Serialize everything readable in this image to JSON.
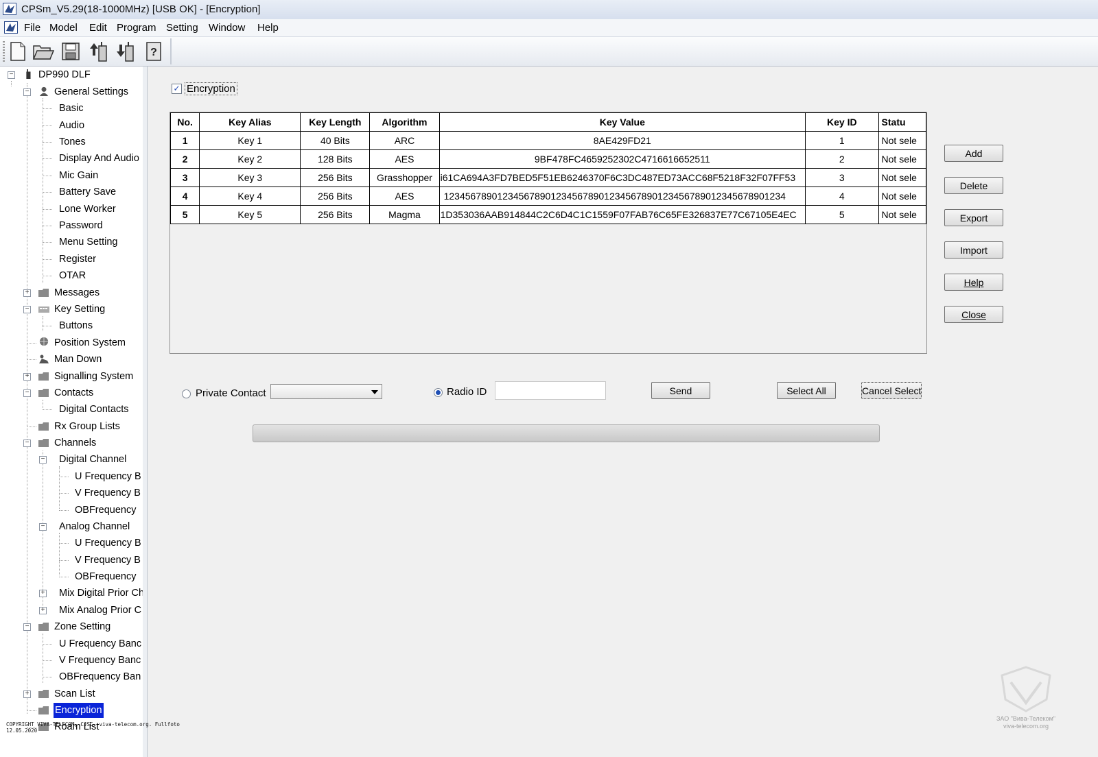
{
  "window": {
    "title": "CPSm_V5.29(18-1000MHz) [USB OK] - [Encryption]"
  },
  "menu": [
    "File",
    "Model",
    "Edit",
    "Program",
    "Setting",
    "Window",
    "Help"
  ],
  "toolbar": {
    "buttons": [
      "new-file-icon",
      "open-folder-icon",
      "save-icon",
      "read-from-radio-icon",
      "write-to-radio-icon",
      "help-book-icon"
    ]
  },
  "tree": {
    "root": "DP990 DLF",
    "items": [
      "General Settings",
      "Basic",
      "Audio",
      "Tones",
      "Display And Audio",
      "Mic Gain",
      "Battery Save",
      "Lone Worker",
      "Password",
      "Menu Setting",
      "Register",
      "OTAR",
      "Messages",
      "Key Setting",
      "Buttons",
      "Position System",
      "Man Down",
      "Signalling System",
      "Contacts",
      "Digital Contacts",
      "Rx Group Lists",
      "Channels",
      "Digital Channel",
      "U Frequency B",
      "V Frequency B",
      "OBFrequency",
      "Analog Channel",
      "U Frequency B",
      "V Frequency B",
      "OBFrequency",
      "Mix Digital Prior Ch",
      "Mix Analog Prior C",
      "Zone Setting",
      "U Frequency Banc",
      "V Frequency Banc",
      "OBFrequency Ban",
      "Scan List",
      "Encryption",
      "Roam List"
    ],
    "selected": "Encryption"
  },
  "encryption": {
    "checkbox_label": "Encryption",
    "checked": true,
    "columns": [
      "No.",
      "Key Alias",
      "Key Length",
      "Algorithm",
      "Key Value",
      "Key ID",
      "Statu"
    ],
    "rows": [
      [
        "1",
        "Key 1",
        "40 Bits",
        "ARC",
        "8AE429FD21",
        "1",
        "Not sele"
      ],
      [
        "2",
        "Key 2",
        "128 Bits",
        "AES",
        "9BF478FC4659252302C4716616652511",
        "2",
        "Not sele"
      ],
      [
        "3",
        "Key 3",
        "256 Bits",
        "Grasshopper",
        "i61CA694A3FD7BED5F51EB6246370F6C3DC487ED73ACC68F5218F32F07FF53",
        "3",
        "Not sele"
      ],
      [
        "4",
        "Key 4",
        "256 Bits",
        "AES",
        "1234567890123456789012345678901234567890123456789012345678901234",
        "4",
        "Not sele"
      ],
      [
        "5",
        "Key 5",
        "256 Bits",
        "Magma",
        "1D353036AAB914844C2C6D4C1C1559F07FAB76C65FE326837E77C67105E4EC",
        "5",
        "Not sele"
      ]
    ],
    "side_buttons": [
      "Add",
      "Delete",
      "Export",
      "Import",
      "Help",
      "Close"
    ],
    "private_contact_label": "Private Contact",
    "private_contact_value": "",
    "radio_id_label": "Radio ID",
    "radio_id_value": "",
    "send_label": "Send",
    "select_all_label": "Select All",
    "cancel_select_label": "Cancel Select"
  },
  "footer": {
    "copyright_line1": "COPYRIGHT VIVA-TELECOM, CJSC. viva-telecom.org. Fullfoto",
    "copyright_line2": "12.05.2020",
    "watermark_line1": "ЗАО \"Вива-Телеком\"",
    "watermark_line2": "viva-telecom.org"
  }
}
